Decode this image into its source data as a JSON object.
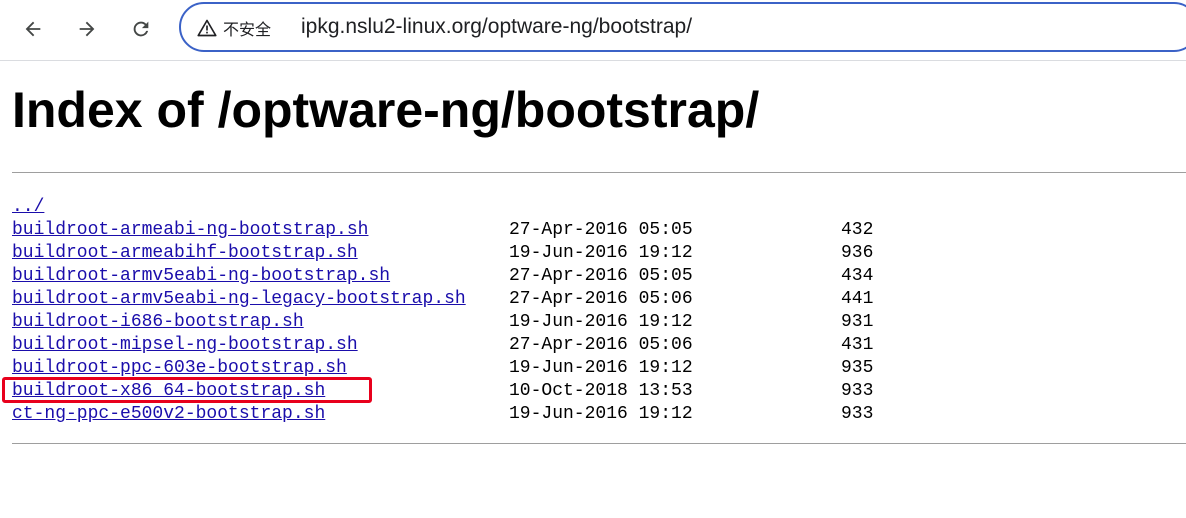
{
  "browser": {
    "back_icon": "arrow-left-icon",
    "forward_icon": "arrow-right-icon",
    "reload_icon": "reload-icon",
    "security_icon": "warning-triangle-icon",
    "security_label": "不安全",
    "url": "ipkg.nslu2-linux.org/optware-ng/bootstrap/"
  },
  "page": {
    "title": "Index of /optware-ng/bootstrap/",
    "parent_link": "../",
    "files": [
      {
        "name": "buildroot-armeabi-ng-bootstrap.sh",
        "date": "27-Apr-2016 05:05",
        "size": "432"
      },
      {
        "name": "buildroot-armeabihf-bootstrap.sh",
        "date": "19-Jun-2016 19:12",
        "size": "936"
      },
      {
        "name": "buildroot-armv5eabi-ng-bootstrap.sh",
        "date": "27-Apr-2016 05:05",
        "size": "434"
      },
      {
        "name": "buildroot-armv5eabi-ng-legacy-bootstrap.sh",
        "date": "27-Apr-2016 05:06",
        "size": "441"
      },
      {
        "name": "buildroot-i686-bootstrap.sh",
        "date": "19-Jun-2016 19:12",
        "size": "931"
      },
      {
        "name": "buildroot-mipsel-ng-bootstrap.sh",
        "date": "27-Apr-2016 05:06",
        "size": "431"
      },
      {
        "name": "buildroot-ppc-603e-bootstrap.sh",
        "date": "19-Jun-2016 19:12",
        "size": "935"
      },
      {
        "name": "buildroot-x86_64-bootstrap.sh",
        "date": "10-Oct-2018 13:53",
        "size": "933"
      },
      {
        "name": "ct-ng-ppc-e500v2-bootstrap.sh",
        "date": "19-Jun-2016 19:12",
        "size": "933"
      }
    ]
  },
  "colors": {
    "link": "#1a0dab",
    "omnibox_border": "#3b62c7",
    "highlight_box": "#e8001c"
  }
}
